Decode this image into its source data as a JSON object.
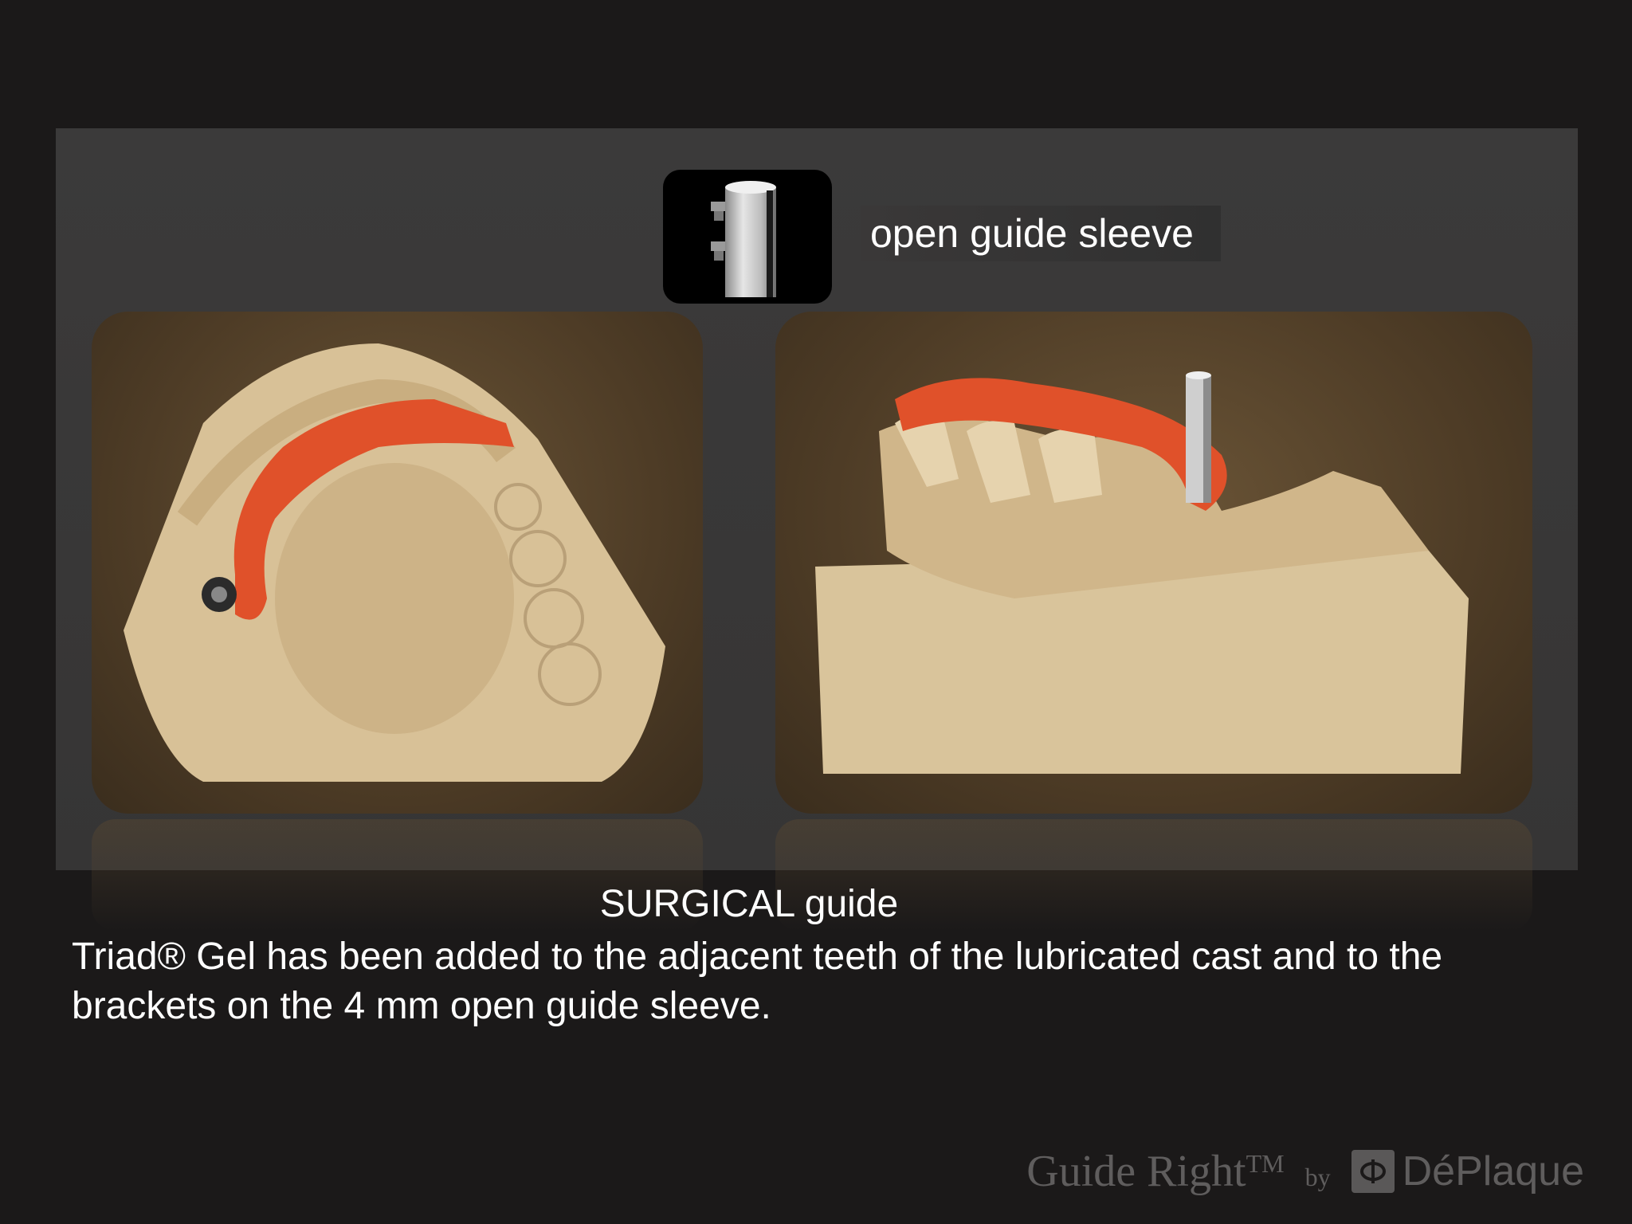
{
  "slide": {
    "sleeve_label": "open guide sleeve",
    "caption_title": "SURGICAL guide",
    "caption_body": "Triad® Gel has been added to the adjacent teeth of the lubricated cast and to the brackets on the 4 mm open guide sleeve."
  },
  "photos": [
    {
      "icon": "dental-cast-occlusal-view"
    },
    {
      "icon": "dental-cast-side-view-with-sleeve"
    }
  ],
  "footer": {
    "brand": "Guide Right",
    "trademark": "TM",
    "by": "by",
    "company": "DéPlaque"
  },
  "colors": {
    "background": "#1b1919",
    "panel": "#3a3939",
    "gel": "#e0512a",
    "plaster": "#d9c39a",
    "text": "#ffffff",
    "footer_text": "#5f5d5d"
  }
}
